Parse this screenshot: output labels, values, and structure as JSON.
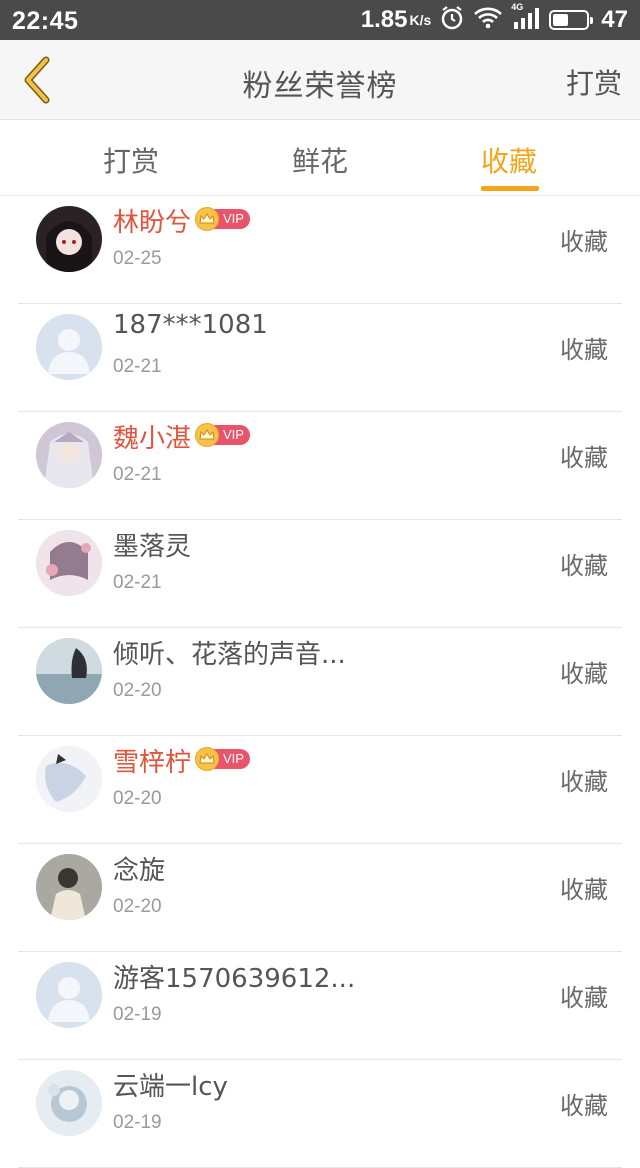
{
  "status_bar": {
    "time": "22:45",
    "speed": "1.85",
    "speed_unit": "K/s",
    "network": "4G",
    "battery": "47",
    "battery_fraction": 0.47
  },
  "nav": {
    "back_icon": "chevron-left-icon",
    "title": "粉丝荣誉榜",
    "action": "打赏"
  },
  "tabs": [
    {
      "label": "打赏",
      "active": false
    },
    {
      "label": "鲜花",
      "active": false
    },
    {
      "label": "收藏",
      "active": true
    }
  ],
  "colors": {
    "accent": "#f3a61b",
    "vip_name": "#e1553e",
    "vip_badge": "#e8556a"
  },
  "vip_label": "VIP",
  "list": [
    {
      "name": "林盼兮",
      "date": "02-25",
      "action": "收藏",
      "vip": true
    },
    {
      "name": "187***1081",
      "date": "02-21",
      "action": "收藏",
      "vip": false
    },
    {
      "name": "魏小湛",
      "date": "02-21",
      "action": "收藏",
      "vip": true
    },
    {
      "name": "墨落灵",
      "date": "02-21",
      "action": "收藏",
      "vip": false
    },
    {
      "name": "倾听、花落的声音...",
      "date": "02-20",
      "action": "收藏",
      "vip": false
    },
    {
      "name": "雪梓柠",
      "date": "02-20",
      "action": "收藏",
      "vip": true
    },
    {
      "name": "念旋",
      "date": "02-20",
      "action": "收藏",
      "vip": false
    },
    {
      "name": "游客1570639612...",
      "date": "02-19",
      "action": "收藏",
      "vip": false
    },
    {
      "name": "云端一lcy",
      "date": "02-19",
      "action": "收藏",
      "vip": false
    }
  ]
}
